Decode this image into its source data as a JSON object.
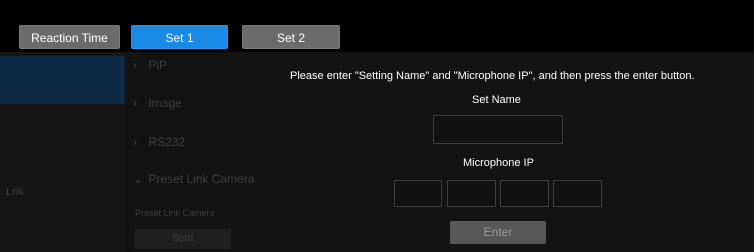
{
  "tabs": [
    {
      "label": "Reaction Time",
      "active": false
    },
    {
      "label": "Set 1",
      "active": true
    },
    {
      "label": "Set 2",
      "active": false
    }
  ],
  "background": {
    "menu_items": [
      "PiP",
      "Image",
      "RS232",
      "Preset Link Camera"
    ],
    "section_label": "Preset Link Camera",
    "start_label": "Start",
    "left_label": "Lnk"
  },
  "dialog": {
    "instruction": "Please enter \"Setting Name\" and \"Microphone IP\", and then press the enter button.",
    "set_name_label": "Set Name",
    "set_name_value": "",
    "mic_ip_label": "Microphone IP",
    "mic_ip_octets": [
      "",
      "",
      "",
      ""
    ],
    "enter_label": "Enter"
  },
  "colors": {
    "active_tab": "#1a8ae6",
    "inactive_tab": "#6b6b6b",
    "enter_button": "#575757"
  }
}
